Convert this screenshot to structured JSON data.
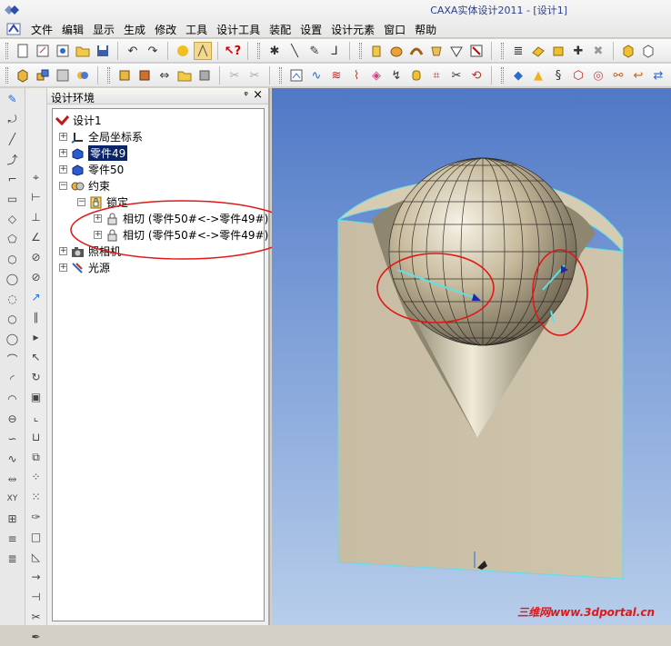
{
  "window": {
    "title": "CAXA实体设计2011 - [设计1]"
  },
  "menu": [
    "文件",
    "编辑",
    "显示",
    "生成",
    "修改",
    "工具",
    "设计工具",
    "装配",
    "设置",
    "设计元素",
    "窗口",
    "帮助"
  ],
  "panel": {
    "title": "设计环境",
    "pin": "ᵠ",
    "close": "×"
  },
  "tree": {
    "root": "设计1",
    "items": [
      {
        "label": "全局坐标系"
      },
      {
        "label": "零件49"
      },
      {
        "label": "零件50"
      },
      {
        "label": "约束"
      },
      {
        "label": "锁定"
      },
      {
        "label": "相切 (零件50#<->零件49#)"
      },
      {
        "label": "相切 (零件50#<->零件49#)"
      },
      {
        "label": "照相机"
      },
      {
        "label": "光源"
      }
    ]
  },
  "watermark": "三维网www.3dportal.cn",
  "colors": {
    "selection": "#0a246a",
    "annotation_red": "#e01818",
    "viewport_top": "#4f78c6",
    "viewport_bottom": "#b7cdea",
    "part_body": "#c9bfa6",
    "edge_highlight": "#5fe0e8"
  }
}
